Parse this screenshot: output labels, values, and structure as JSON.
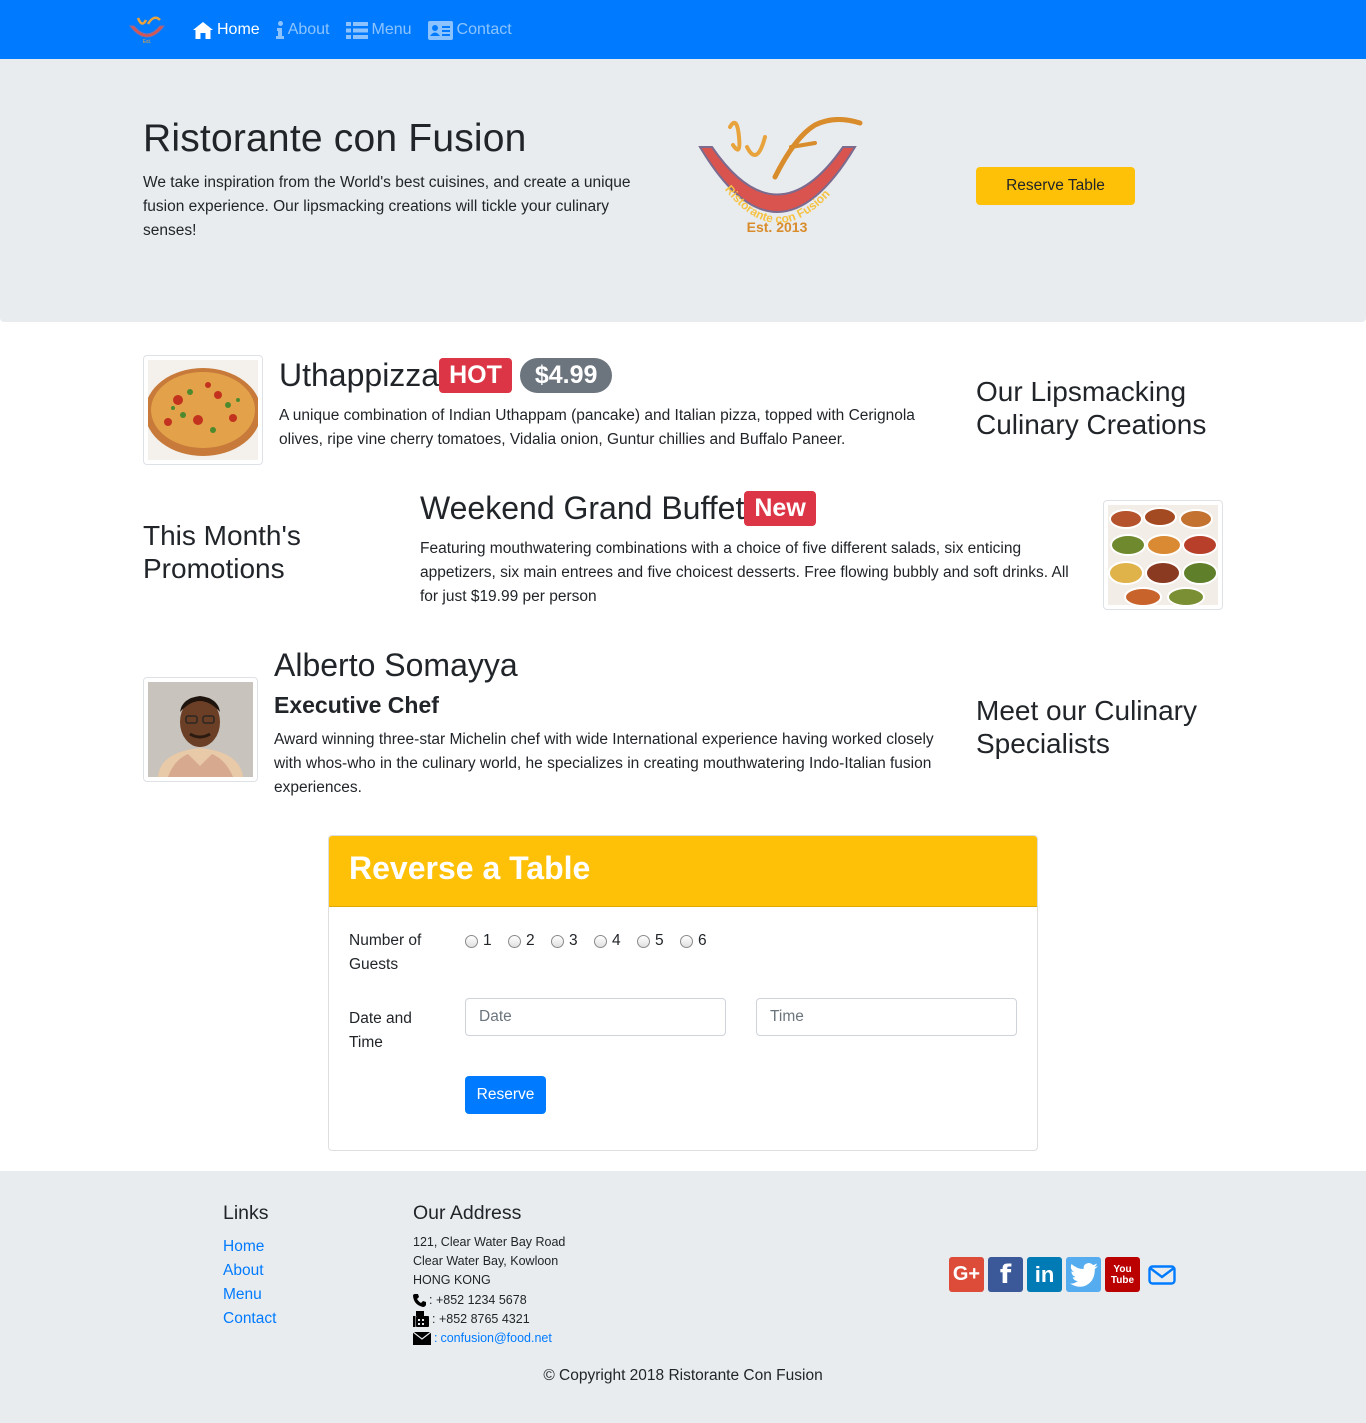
{
  "navbar": {
    "logo_alt": "Ristorante Con Fusion",
    "items": [
      {
        "label": "Home",
        "icon": "home-icon",
        "active": true
      },
      {
        "label": "About",
        "icon": "info-icon",
        "active": false
      },
      {
        "label": "Menu",
        "icon": "list-icon",
        "active": false
      },
      {
        "label": "Contact",
        "icon": "address-card-icon",
        "active": false
      }
    ]
  },
  "jumbotron": {
    "title": "Ristorante con Fusion",
    "text": "We take inspiration from the World's best cuisines, and create a unique fusion experience. Our lipsmacking creations will tickle your culinary senses!",
    "logo_text": "Ristorante con Fusion",
    "logo_est": "Est. 2013",
    "reserve_button": "Reserve Table"
  },
  "dish": {
    "name": "Uthappizza",
    "badge": "HOT",
    "price": "$4.99",
    "description": "A unique combination of Indian Uthappam (pancake) and Italian pizza, topped with Cerignola olives, ripe vine cherry tomatoes, Vidalia onion, Guntur chillies and Buffalo Paneer.",
    "side_heading": "Our Lipsmacking Culinary Creations"
  },
  "promotion": {
    "name": "Weekend Grand Buffet",
    "badge": "New",
    "description": "Featuring mouthwatering combinations with a choice of five different salads, six enticing appetizers, six main entrees and five choicest desserts. Free flowing bubbly and soft drinks. All for just $19.99 per person",
    "side_heading": "This Month's Promotions"
  },
  "leader": {
    "name": "Alberto Somayya",
    "designation": "Executive Chef",
    "description": "Award winning three-star Michelin chef with wide International experience having worked closely with whos-who in the culinary world, he specializes in creating mouthwatering Indo-Italian fusion experiences.",
    "side_heading": "Meet our Culinary Specialists"
  },
  "reservation": {
    "title": "Reverse a Table",
    "guests_label": "Number of Guests",
    "guest_options": [
      "1",
      "2",
      "3",
      "4",
      "5",
      "6"
    ],
    "datetime_label": "Date and Time",
    "date_placeholder": "Date",
    "time_placeholder": "Time",
    "submit": "Reserve"
  },
  "footer": {
    "links_heading": "Links",
    "links": [
      "Home",
      "About",
      "Menu",
      "Contact"
    ],
    "address_heading": "Our Address",
    "address_lines": [
      "121, Clear Water Bay Road",
      "Clear Water Bay, Kowloon",
      "HONG KONG"
    ],
    "phone": ": +852 1234 5678",
    "fax": ": +852 8765 4321",
    "email_prefix": ":",
    "email": "confusion@food.net",
    "social": [
      {
        "name": "google-plus",
        "color": "#dd4b39",
        "label": "G+"
      },
      {
        "name": "facebook",
        "color": "#3b5998",
        "label": "f"
      },
      {
        "name": "linkedin",
        "color": "#007bb6",
        "label": "in"
      },
      {
        "name": "twitter",
        "color": "#55acee",
        "label": ""
      },
      {
        "name": "youtube",
        "color": "#bb0000",
        "label": "You Tube"
      },
      {
        "name": "mail",
        "color": "#007bff",
        "label": ""
      }
    ],
    "copyright": "© Copyright 2018 Ristorante Con Fusion"
  },
  "colors": {
    "primary": "#007bff",
    "warning": "#ffc107",
    "danger": "#dc3545",
    "secondary": "#6c757d",
    "light": "#e9ecef"
  }
}
